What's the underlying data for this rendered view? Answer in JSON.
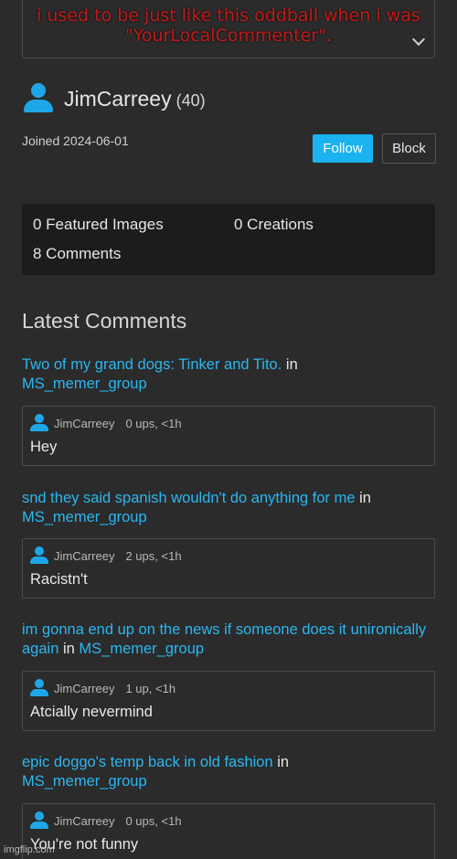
{
  "caption": "i used to be just like this oddball when i was \"YourLocalCommenter\".",
  "profile": {
    "username": "JimCarreey",
    "points": "(40)",
    "joined": "Joined 2024-06-01",
    "follow_label": "Follow",
    "block_label": "Block"
  },
  "stats": {
    "featured": "0 Featured Images",
    "creations": "0 Creations",
    "comments": "8 Comments"
  },
  "section_title": "Latest Comments",
  "in_word": "in",
  "comments": [
    {
      "post": "Two of my grand dogs: Tinker and Tito.",
      "stream": "MS_memer_group",
      "author": "JimCarreey",
      "ups": "0 ups, <1h",
      "text": "Hey"
    },
    {
      "post": "snd they said spanish wouldn't do anything for me",
      "stream": "MS_memer_group",
      "author": "JimCarreey",
      "ups": "2 ups, <1h",
      "text": "Racistn't"
    },
    {
      "post": "im gonna end up on the news if someone does it unironically again",
      "stream": "MS_memer_group",
      "author": "JimCarreey",
      "ups": "1 up, <1h",
      "text": "Atcially nevermind"
    },
    {
      "post": "epic doggo's temp back in old fashion",
      "stream": "MS_memer_group",
      "author": "JimCarreey",
      "ups": "0 ups, <1h",
      "text": "You're not funny"
    }
  ],
  "watermark": "imgflip.com",
  "colors": {
    "accent": "#1ab2ef",
    "link": "#2bb7f0",
    "background": "#2b2b2b",
    "panel": "#1c1c1c",
    "caption": "#c21b1b"
  },
  "icons": {
    "avatar": "user-avatar-icon",
    "dropdown": "chevron-down-icon"
  }
}
